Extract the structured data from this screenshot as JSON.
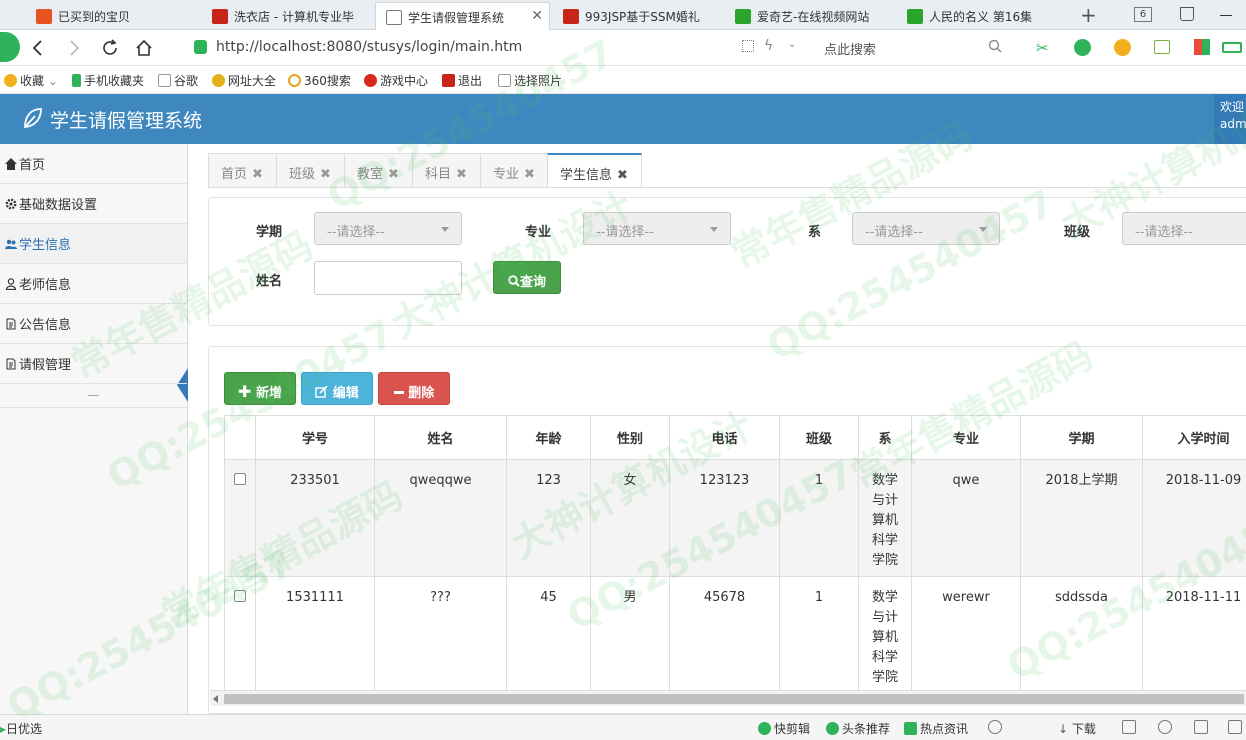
{
  "browser": {
    "tabs": [
      {
        "label": "已买到的宝贝",
        "color": "#e8541e"
      },
      {
        "label": "洗衣店 - 计算机专业毕",
        "color": "#c9241a"
      },
      {
        "label": "学生请假管理系统",
        "color": "#777777"
      },
      {
        "label": "993JSP基于SSM婚礼",
        "color": "#c9241a"
      },
      {
        "label": "爱奇艺-在线视频网站",
        "color": "#2aa52a"
      },
      {
        "label": "人民的名义 第16集",
        "color": "#2aa52a"
      }
    ],
    "tab_close": "✕",
    "new_tab": "+",
    "tab_count": "6",
    "url": "http://localhost:8080/stusys/login/main.htm",
    "search_placeholder": "点此搜索",
    "bookmarks": [
      "收藏",
      "手机收藏夹",
      "谷歌",
      "网址大全",
      "360搜索",
      "游戏中心",
      "退出",
      "选择照片"
    ]
  },
  "app": {
    "title": "学生请假管理系统",
    "welcome_line1": "欢迎",
    "welcome_line2": "adm"
  },
  "sidebar": {
    "items": [
      {
        "label": "首页",
        "icon": "home-icon"
      },
      {
        "label": "基础数据设置",
        "icon": "gear-icon"
      },
      {
        "label": "学生信息",
        "icon": "users-icon"
      },
      {
        "label": "老师信息",
        "icon": "user-icon"
      },
      {
        "label": "公告信息",
        "icon": "document-icon"
      },
      {
        "label": "请假管理",
        "icon": "document-icon"
      }
    ],
    "collapse": "—"
  },
  "page_tabs": [
    "首页",
    "班级",
    "教室",
    "科目",
    "专业",
    "学生信息"
  ],
  "tab_close": "✖",
  "filter": {
    "term_label": "学期",
    "major_label": "专业",
    "dept_label": "系",
    "class_label": "班级",
    "name_label": "姓名",
    "select_placeholder": "--请选择--",
    "query_button": "查询"
  },
  "actions": {
    "add": "新增",
    "edit": "编辑",
    "delete": "删除"
  },
  "table": {
    "headers": [
      "学号",
      "姓名",
      "年龄",
      "性别",
      "电话",
      "班级",
      "系",
      "专业",
      "学期",
      "入学时间"
    ],
    "rows": [
      [
        "233501",
        "qweqqwe",
        "123",
        "女",
        "123123",
        "1",
        "数学与计算机科学学院",
        "qwe",
        "2018上学期",
        "2018-11-09"
      ],
      [
        "1531111",
        "???",
        "45",
        "男",
        "45678",
        "1",
        "数学与计算机科学学院",
        "werewr",
        "sddssda",
        "2018-11-11"
      ]
    ]
  },
  "status_bar": {
    "left": "日优选",
    "items": [
      "快剪辑",
      "头条推荐",
      "热点资讯",
      "下载"
    ]
  },
  "watermarks": [
    "QQ:254540457",
    "常年售精品源码",
    "大神计算机设计"
  ]
}
